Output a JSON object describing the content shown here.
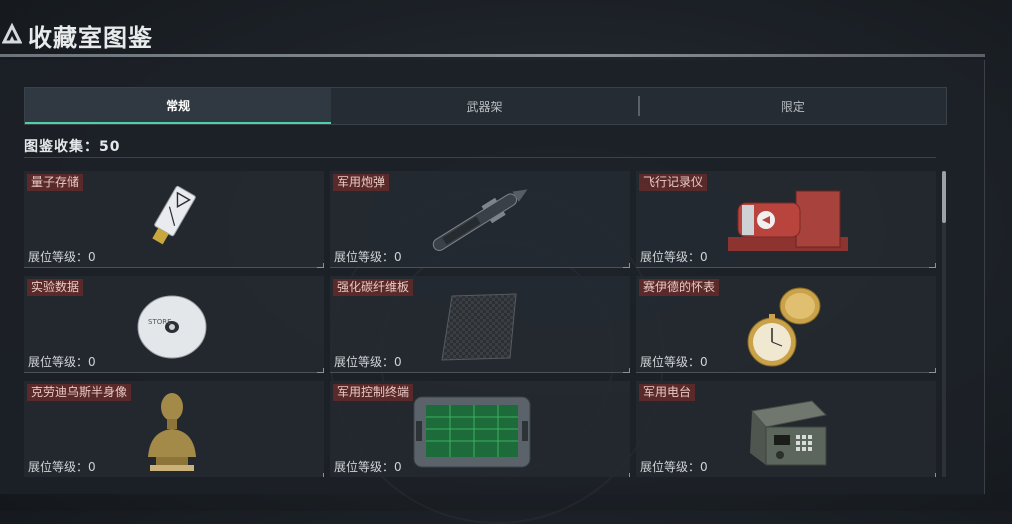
{
  "header": {
    "title": "收藏室图鉴",
    "icon": "triangle-logo-icon"
  },
  "tabs": [
    {
      "label": "常规",
      "active": true
    },
    {
      "label": "武器架",
      "active": false
    },
    {
      "label": "限定",
      "active": false
    }
  ],
  "collection": {
    "label": "图鉴收集：50"
  },
  "level_label": "展位等级：",
  "items": [
    {
      "name": "量子存储",
      "level": "0",
      "icon": "usb-drive-icon"
    },
    {
      "name": "军用炮弹",
      "level": "0",
      "icon": "shell-icon"
    },
    {
      "name": "飞行记录仪",
      "level": "0",
      "icon": "flight-recorder-icon"
    },
    {
      "name": "实验数据",
      "level": "0",
      "icon": "disc-icon"
    },
    {
      "name": "强化碳纤维板",
      "level": "0",
      "icon": "carbon-plate-icon"
    },
    {
      "name": "赛伊德的怀表",
      "level": "0",
      "icon": "pocket-watch-icon"
    },
    {
      "name": "克劳迪乌斯半身像",
      "level": "0",
      "icon": "bust-icon"
    },
    {
      "name": "军用控制终端",
      "level": "0",
      "icon": "control-terminal-icon"
    },
    {
      "name": "军用电台",
      "level": "0",
      "icon": "radio-icon"
    }
  ],
  "colors": {
    "accent": "#4fd1a5",
    "name_tag_bg": "#5a2a2a"
  }
}
